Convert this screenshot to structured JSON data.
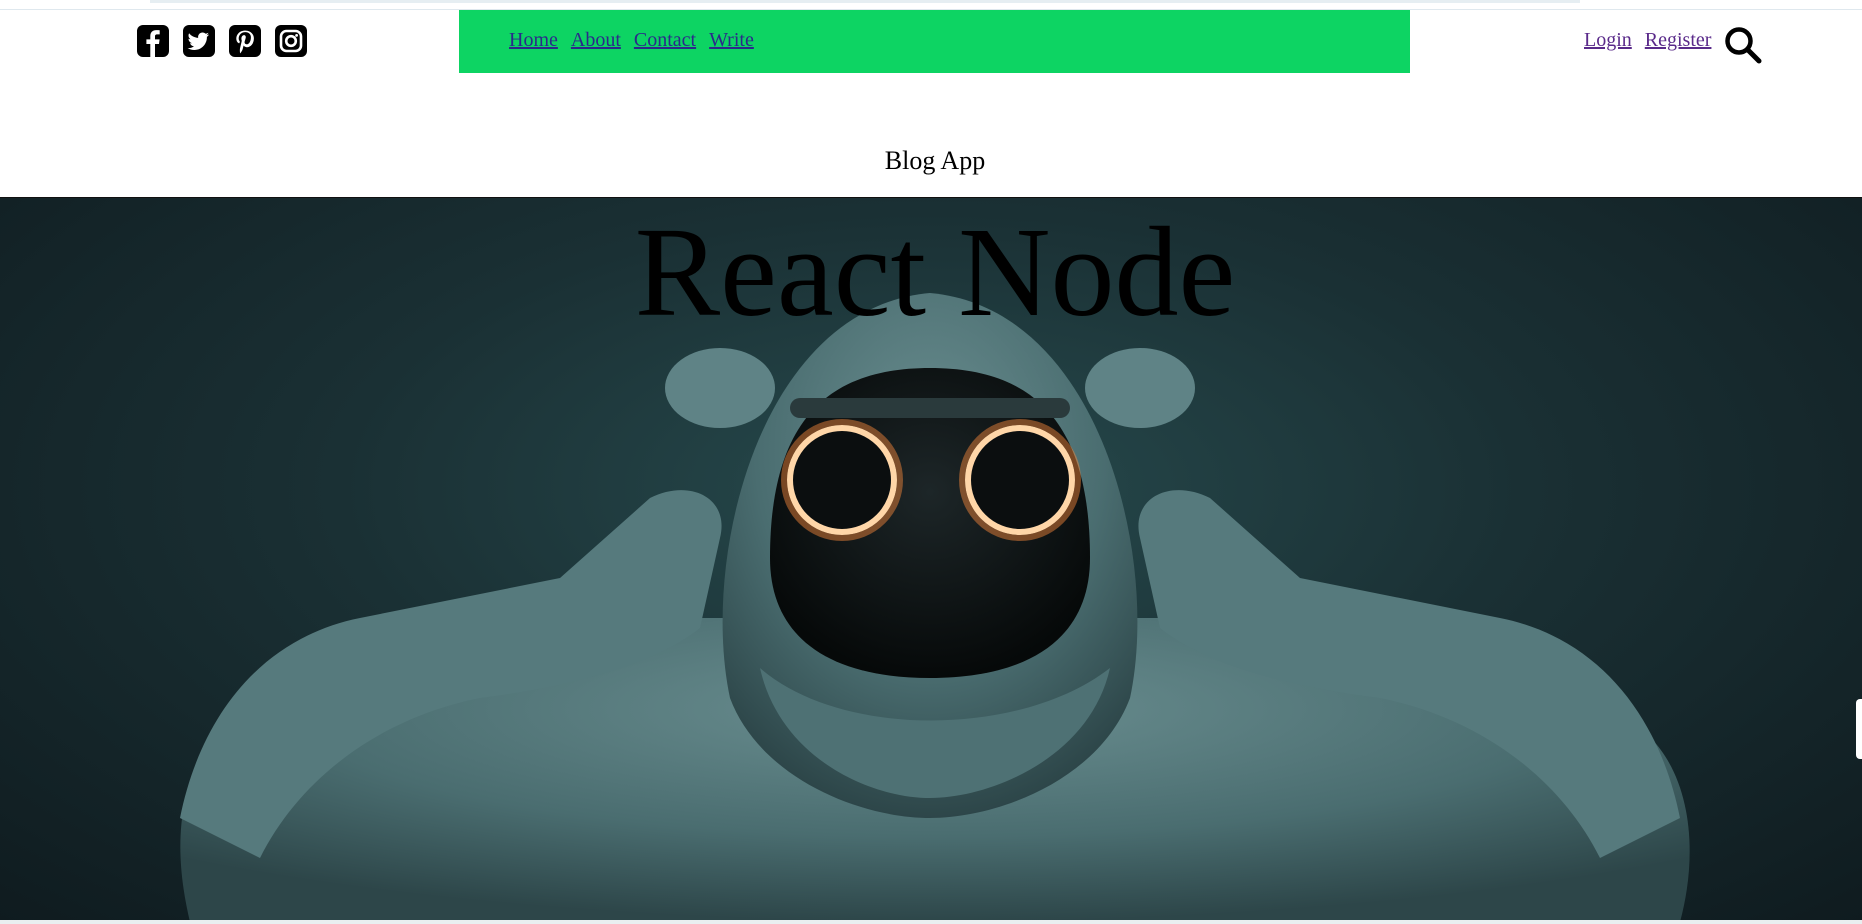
{
  "social": {
    "icons": [
      "facebook-square-icon",
      "twitter-square-icon",
      "pinterest-square-icon",
      "instagram-icon"
    ]
  },
  "nav": {
    "items": [
      {
        "label": "Home"
      },
      {
        "label": "About"
      },
      {
        "label": "Contact"
      },
      {
        "label": "Write"
      }
    ],
    "background": "#0dd463"
  },
  "auth": {
    "login_label": "Login",
    "register_label": "Register"
  },
  "search": {
    "icon": "search-icon"
  },
  "site": {
    "title": "Blog App"
  },
  "hero": {
    "title": "React Node",
    "image_subject": "hooded figure with glowing ring eyes"
  }
}
